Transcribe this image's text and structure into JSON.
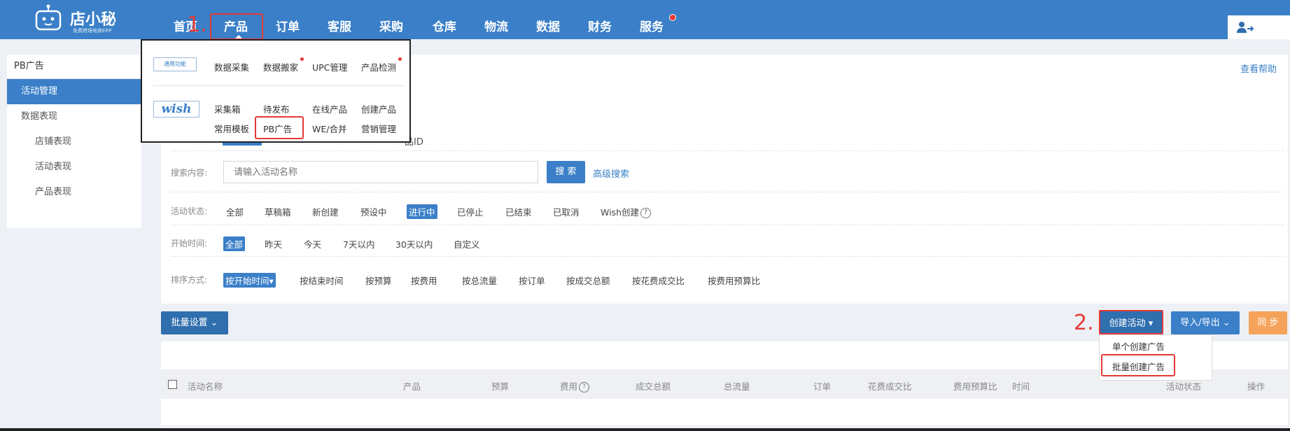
{
  "header": {
    "logo_name": "店小秘",
    "logo_sub": "免费跨境电商ERP",
    "nav": [
      "首页",
      "产品",
      "订单",
      "客服",
      "采购",
      "仓库",
      "物流",
      "数据",
      "财务",
      "服务"
    ],
    "annotation_1": "1.",
    "colors": {
      "bar": "#3a7fc8",
      "highlight": "#e53935"
    }
  },
  "sidebar": {
    "title": "PB广告",
    "items": [
      "活动管理",
      "数据表现",
      "店铺表现",
      "活动表现",
      "产品表现"
    ]
  },
  "dropdown": {
    "general_badge": "通用功能",
    "general_items": [
      "数据采集",
      "数据搬家",
      "UPC管理",
      "产品检测"
    ],
    "wish_badge": "wish",
    "wish_row1": [
      "采集箱",
      "待发布",
      "在线产品",
      "创建产品"
    ],
    "wish_row2": [
      "常用模板",
      "PB广告",
      "WE/合并",
      "营销管理"
    ]
  },
  "main": {
    "help_link": "查看帮助",
    "product_id_fragment": "品ID",
    "search_label": "搜索内容:",
    "search_placeholder": "请输入活动名称",
    "search_button": "搜 索",
    "advanced_search": "高级搜索",
    "status_label": "活动状态:",
    "status_options": [
      "全部",
      "草稿箱",
      "新创建",
      "预设中",
      "进行中",
      "已停止",
      "已结束",
      "已取消",
      "Wish创建"
    ],
    "status_selected": "进行中",
    "help_q": "?",
    "start_label": "开始时间:",
    "start_options": [
      "全部",
      "昨天",
      "今天",
      "7天以内",
      "30天以内",
      "自定义"
    ],
    "start_selected": "全部",
    "sort_label": "排序方式:",
    "sort_options": [
      "按开始时间▾",
      "按结束时间",
      "按预算",
      "按费用",
      "按总流量",
      "按订单",
      "按成交总额",
      "按花费成交比",
      "按费用预算比"
    ],
    "sort_selected": "按开始时间▾"
  },
  "toolbar": {
    "bulk_settings": "批量设置 ⌄",
    "create_activity": "创建活动 ▾",
    "import_export": "导入/导出 ⌄",
    "sync": "同 步",
    "annotation_2": "2.",
    "create_menu": [
      "单个创建广告",
      "批量创建广告"
    ]
  },
  "table": {
    "columns": [
      "活动名称",
      "产品",
      "预算",
      "费用",
      "成交总额",
      "总流量",
      "订单",
      "花费成交比",
      "费用预算比",
      "时间",
      "活动状态",
      "操作"
    ]
  }
}
